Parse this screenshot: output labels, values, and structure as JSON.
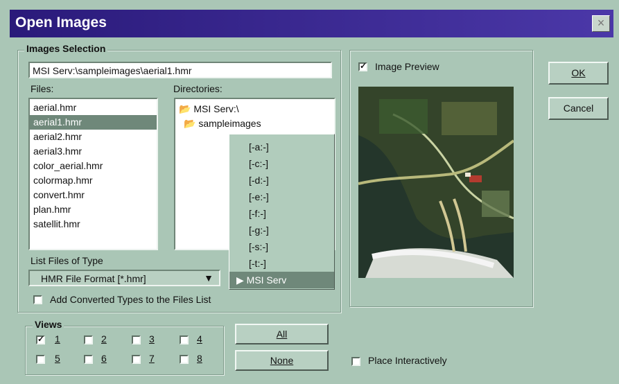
{
  "window": {
    "title": "Open Images"
  },
  "images_selection": {
    "label": "Images Selection",
    "path": "MSI Serv:\\sampleimages\\aerial1.hmr",
    "files_label": "Files:",
    "directories_label": "Directories:",
    "files": [
      "aerial.hmr",
      "aerial1.hmr",
      "aerial2.hmr",
      "aerial3.hmr",
      "color_aerial.hmr",
      "colormap.hmr",
      "convert.hmr",
      "plan.hmr",
      "satellit.hmr"
    ],
    "selected_file": "aerial1.hmr",
    "directories": [
      "MSI Serv:\\",
      "sampleimages"
    ],
    "drive_options": [
      "[-a:-]",
      "[-c:-]",
      "[-d:-]",
      "[-e:-]",
      "[-f:-]",
      "[-g:-]",
      "[-s:-]",
      "[-t:-]",
      "MSI Serv"
    ],
    "selected_drive": "MSI Serv",
    "list_files_type_label": "List Files of Type",
    "file_type": "HMR File Format [*.hmr]",
    "add_converted_label": "Add Converted Types to the Files List",
    "add_converted_checked": false
  },
  "preview": {
    "label": "Image Preview",
    "checked": true
  },
  "buttons": {
    "ok": "OK",
    "cancel": "Cancel",
    "all": "All",
    "none": "None"
  },
  "views": {
    "label": "Views",
    "items": [
      {
        "label": "1",
        "checked": true
      },
      {
        "label": "2",
        "checked": false
      },
      {
        "label": "3",
        "checked": false
      },
      {
        "label": "4",
        "checked": false
      },
      {
        "label": "5",
        "checked": false
      },
      {
        "label": "6",
        "checked": false
      },
      {
        "label": "7",
        "checked": false
      },
      {
        "label": "8",
        "checked": false
      }
    ]
  },
  "place_interactively": {
    "label": "Place Interactively",
    "checked": false
  }
}
